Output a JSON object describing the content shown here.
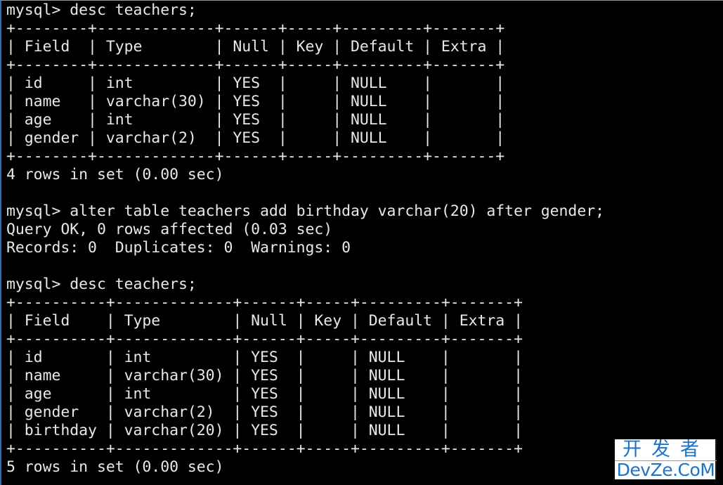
{
  "terminal": {
    "lines": [
      "mysql> desc teachers;",
      "+--------+-------------+------+-----+---------+-------+",
      "| Field  | Type        | Null | Key | Default | Extra |",
      "+--------+-------------+------+-----+---------+-------+",
      "| id     | int         | YES  |     | NULL    |       |",
      "| name   | varchar(30) | YES  |     | NULL    |       |",
      "| age    | int         | YES  |     | NULL    |       |",
      "| gender | varchar(2)  | YES  |     | NULL    |       |",
      "+--------+-------------+------+-----+---------+-------+",
      "4 rows in set (0.00 sec)",
      "",
      "mysql> alter table teachers add birthday varchar(20) after gender;",
      "Query OK, 0 rows affected (0.03 sec)",
      "Records: 0  Duplicates: 0  Warnings: 0",
      "",
      "mysql> desc teachers;",
      "+----------+-------------+------+-----+---------+-------+",
      "| Field    | Type        | Null | Key | Default | Extra |",
      "+----------+-------------+------+-----+---------+-------+",
      "| id       | int         | YES  |     | NULL    |       |",
      "| name     | varchar(30) | YES  |     | NULL    |       |",
      "| age      | int         | YES  |     | NULL    |       |",
      "| gender   | varchar(2)  | YES  |     | NULL    |       |",
      "| birthday | varchar(20) | YES  |     | NULL    |       |",
      "+----------+-------------+------+-----+---------+-------+",
      "5 rows in set (0.00 sec)"
    ]
  },
  "watermark": {
    "chinese": "开发者",
    "english": "DevZe.CoM"
  },
  "colors": {
    "background": "#000000",
    "text": "#e8e8e8",
    "watermark_blue": "#1a73c9"
  }
}
